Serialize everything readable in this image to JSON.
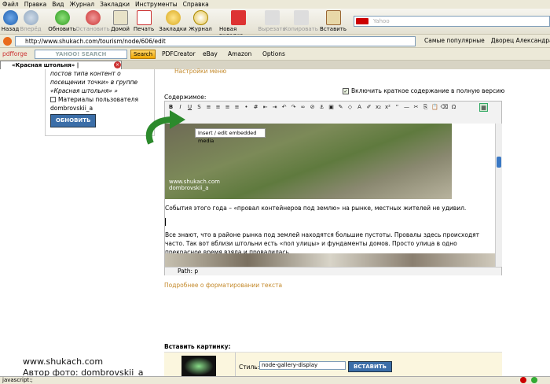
{
  "menu": [
    "Файл",
    "Правка",
    "Вид",
    "Журнал",
    "Закладки",
    "Инструменты",
    "Справка"
  ],
  "toolbar": {
    "buttons": [
      {
        "label": "Назад"
      },
      {
        "label": "Вперёд"
      },
      {
        "label": "Обновить"
      },
      {
        "label": "Остановить"
      },
      {
        "label": "Домой"
      },
      {
        "label": "Печать"
      },
      {
        "label": "Закладки"
      },
      {
        "label": "Журнал"
      },
      {
        "label": "Новая вкладка"
      },
      {
        "label": "Вырезать"
      },
      {
        "label": "Копировать"
      },
      {
        "label": "Вставить"
      }
    ],
    "search_placeholder": "Yahoo"
  },
  "address": {
    "url": "http://www.shukach.com/tourism/node/606/edit",
    "bookmark1": "Самые популярные",
    "bookmark2": "Дворец Александра Э..."
  },
  "yahoo": {
    "brand": "pdfforge",
    "logo": "YAHOO! SEARCH",
    "search_btn": "Search",
    "pdfcreator": "PDFCreator",
    "ebay": "eBay",
    "amazon": "Amazon",
    "options": "Options"
  },
  "tab": {
    "title": "«Красная штольня» |"
  },
  "sidebar": {
    "line1": "постов типа контент о",
    "line2": "посещении точки» в группе",
    "line3": "«Красная штольня» »",
    "line4": "Материалы пользователя",
    "line5": "dombrovskii_a",
    "button": "ОБНОВИТЬ"
  },
  "main": {
    "settings_link": "Настройки меню",
    "summary_checkbox": "Включить краткое содержание в полную версию",
    "body_label": "Содержимое:",
    "tooltip": "Insert / edit embedded media",
    "photo_caption1": "www.shukach.com",
    "photo_caption2": "dombrovskii_a",
    "para1": "События этого года – «провал контейнеров под землю» на рынке, местных жителей не удивил.",
    "para2": "Все знают, что в районе рынка под землей находятся большие пустоты. Провалы здесь происходят часто. Так вот вблизи штольни есть «пол улицы» и фундаменты домов. Просто улица в одно прекрасное время взяла и провалилась.",
    "path": "Path: p",
    "format_link": "Подробнее о форматировании текста",
    "insert_images": "Вставить картинку:",
    "style_label": "Стиль:",
    "style_value": "node-gallery-display",
    "insert_btn": "ВСТАВИТЬ"
  },
  "watermark": {
    "line1": "www.shukach.com",
    "line2": "Автор фото: dombrovskii_a"
  },
  "status": {
    "text": "javascript:;"
  }
}
